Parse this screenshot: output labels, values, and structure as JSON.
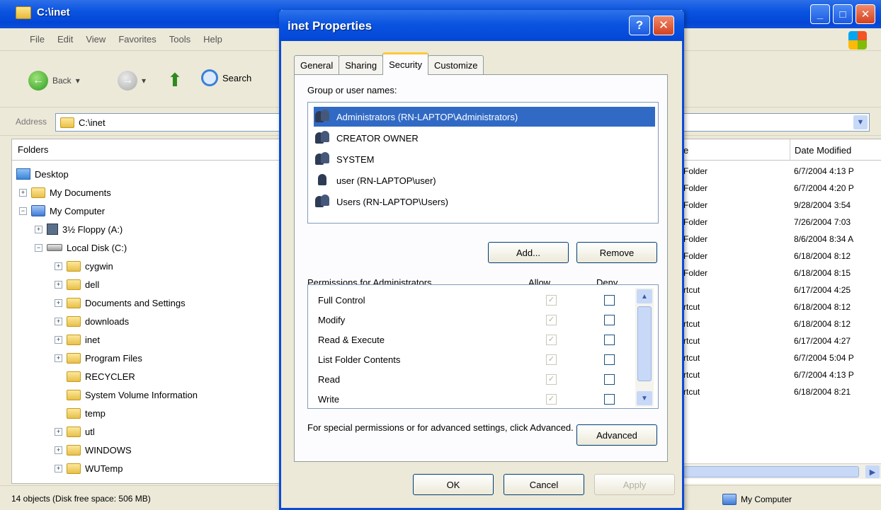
{
  "explorer": {
    "title": "C:\\inet",
    "menu": [
      "File",
      "Edit",
      "View",
      "Favorites",
      "Tools",
      "Help"
    ],
    "toolbar": {
      "back": "Back",
      "search": "Search"
    },
    "address": {
      "label": "Address",
      "value": "C:\\inet"
    },
    "folders_header": "Folders",
    "tree": [
      "Desktop",
      "My Documents",
      "My Computer",
      "3½ Floppy (A:)",
      "Local Disk (C:)",
      "cygwin",
      "dell",
      "Documents and Settings",
      "downloads",
      "inet",
      "Program Files",
      "RECYCLER",
      "System Volume Information",
      "temp",
      "utl",
      "WINDOWS",
      "WUTemp"
    ],
    "list_headers": {
      "type": "e",
      "date": "Date Modified"
    },
    "rows": [
      {
        "type": "Folder",
        "date": "6/7/2004 4:13 P"
      },
      {
        "type": "Folder",
        "date": "6/7/2004 4:20 P"
      },
      {
        "type": "Folder",
        "date": "9/28/2004 3:54"
      },
      {
        "type": "Folder",
        "date": "7/26/2004 7:03"
      },
      {
        "type": "Folder",
        "date": "8/6/2004 8:34 A"
      },
      {
        "type": "Folder",
        "date": "6/18/2004 8:12"
      },
      {
        "type": "Folder",
        "date": "6/18/2004 8:15"
      },
      {
        "type": "rtcut",
        "date": "6/17/2004 4:25"
      },
      {
        "type": "rtcut",
        "date": "6/18/2004 8:12"
      },
      {
        "type": "rtcut",
        "date": "6/18/2004 8:12"
      },
      {
        "type": "rtcut",
        "date": "6/17/2004 4:27"
      },
      {
        "type": "rtcut",
        "date": "6/7/2004 5:04 P"
      },
      {
        "type": "rtcut",
        "date": "6/7/2004 4:13 P"
      },
      {
        "type": "rtcut",
        "date": "6/18/2004 8:21"
      }
    ],
    "status": {
      "left": "14 objects (Disk free space: 506 MB)",
      "right": "My Computer"
    }
  },
  "dialog": {
    "title": "inet Properties",
    "tabs": [
      "General",
      "Sharing",
      "Security",
      "Customize"
    ],
    "active_tab": "Security",
    "group_label": "Group or user names:",
    "users": [
      "Administrators (RN-LAPTOP\\Administrators)",
      "CREATOR OWNER",
      "SYSTEM",
      "user (RN-LAPTOP\\user)",
      "Users (RN-LAPTOP\\Users)"
    ],
    "add_button": "Add...",
    "remove_button": "Remove",
    "permissions_label": "Permissions for Administrators",
    "allow_header": "Allow",
    "deny_header": "Deny",
    "permissions": [
      {
        "name": "Full Control",
        "allow": true,
        "deny": false
      },
      {
        "name": "Modify",
        "allow": true,
        "deny": false
      },
      {
        "name": "Read & Execute",
        "allow": true,
        "deny": false
      },
      {
        "name": "List Folder Contents",
        "allow": true,
        "deny": false
      },
      {
        "name": "Read",
        "allow": true,
        "deny": false
      },
      {
        "name": "Write",
        "allow": true,
        "deny": false
      }
    ],
    "advanced_text": "For special permissions or for advanced settings, click Advanced.",
    "advanced_button": "Advanced",
    "ok_button": "OK",
    "cancel_button": "Cancel",
    "apply_button": "Apply"
  }
}
